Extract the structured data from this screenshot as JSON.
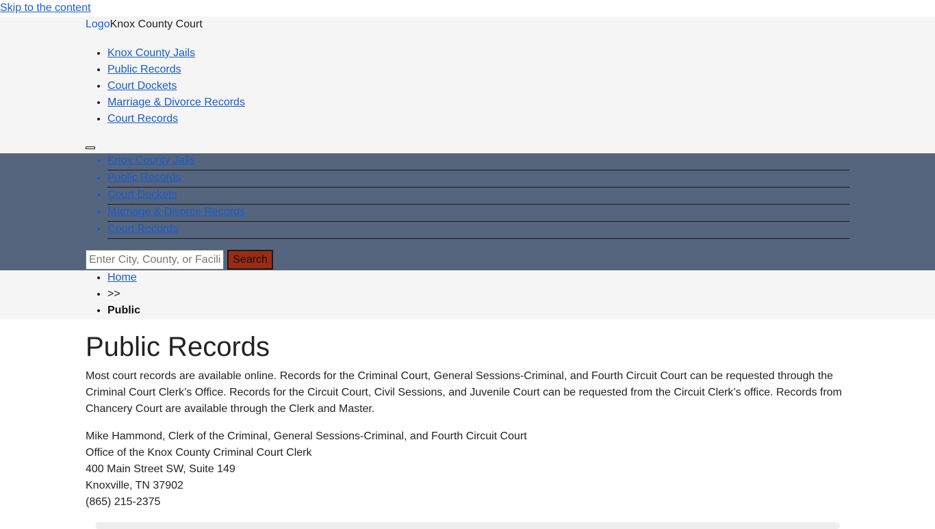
{
  "skip_link": "Skip to the content",
  "brand": {
    "logo_alt": "Logo",
    "site_name": "Knox County Court"
  },
  "nav": {
    "items": [
      {
        "label": "Knox County Jails"
      },
      {
        "label": "Public Records"
      },
      {
        "label": "Court Dockets"
      },
      {
        "label": "Marriage & Divorce Records"
      },
      {
        "label": "Court Records"
      }
    ]
  },
  "search": {
    "placeholder": "Enter City, County, or Facility",
    "button_label": "Search"
  },
  "breadcrumb": {
    "home": "Home",
    "separator": ">>",
    "current": "Public"
  },
  "main": {
    "title": "Public Records",
    "intro": "Most court records are available online. Records for the Criminal Court, General Sessions-Criminal, and Fourth Circuit Court can be requested through the Criminal Court Clerk’s Office. Records for the Circuit Court, Civil Sessions, and Juvenile Court can be requested from the Circuit Clerk’s office. Records from Chancery Court are available through the Clerk and Master.",
    "address": {
      "line1": "Mike Hammond, Clerk of the Criminal, General Sessions-Criminal, and Fourth Circuit Court",
      "line2": "Office of the Knox County Criminal Court Clerk",
      "line3": "400 Main Street SW, Suite 149",
      "line4": "Knoxville, TN 37902",
      "line5": "(865) 215-2375"
    }
  },
  "colors": {
    "link": "#1a5ccc",
    "header_bg": "#f5f5f5",
    "nav_band_bg": "#55657e",
    "search_button_bg": "#9b2c12"
  }
}
